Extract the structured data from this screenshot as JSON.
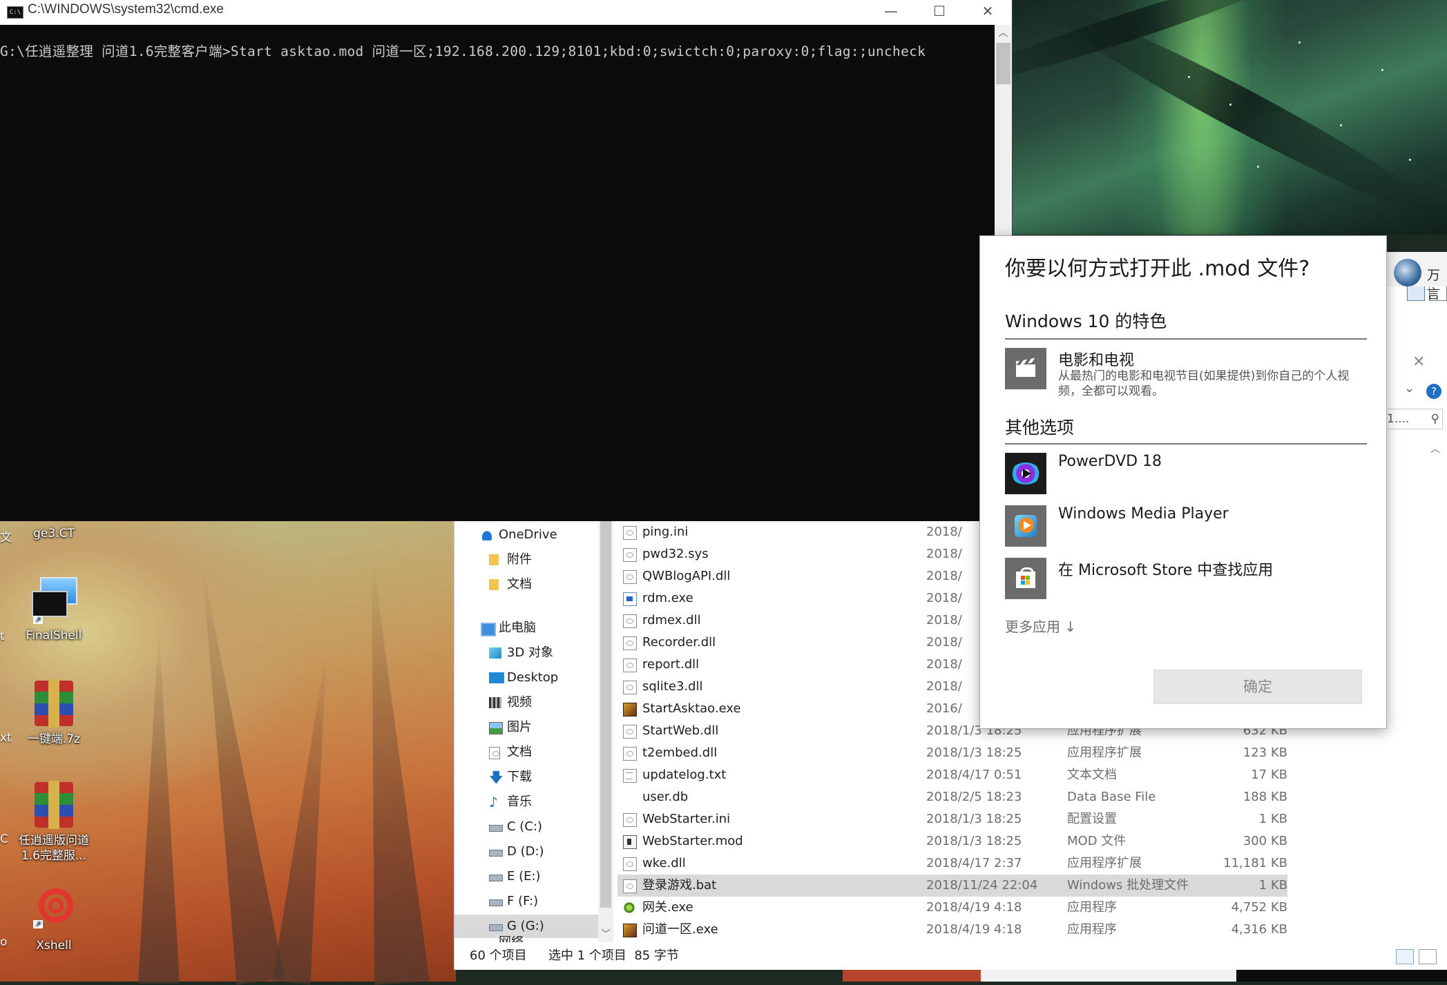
{
  "cmd": {
    "title": "C:\\WINDOWS\\system32\\cmd.exe",
    "icon_text": "C:\\",
    "command_line": "G:\\任逍遥整理 问道1.6完整客户端>Start asktao.mod 问道一区;192.168.200.129;8101;kbd:0;swictch:0;paroxy:0;flag:;uncheck",
    "buttons": {
      "minimize": "—",
      "maximize": "☐",
      "close": "✕"
    }
  },
  "desktop": {
    "icons": [
      {
        "label": "ge3.CT",
        "icon": "file-icon"
      },
      {
        "label": "FinalShell",
        "icon": "monitor-icon"
      },
      {
        "label": "一键端.7z",
        "icon": "archive-icon"
      },
      {
        "label": "任逍遥版问道\n1.6完整服...",
        "icon": "archive-icon"
      },
      {
        "label": "Xshell",
        "icon": "shell-icon"
      }
    ],
    "edge_labels": [
      "文",
      "t",
      "xt",
      "C",
      "o"
    ]
  },
  "explorer": {
    "nav": [
      {
        "label": "OneDrive",
        "icon": "cloud-icon"
      },
      {
        "label": "附件",
        "icon": "folder-icon"
      },
      {
        "label": "文档",
        "icon": "folder-icon"
      },
      {
        "label": "此电脑",
        "icon": "pc-icon"
      },
      {
        "label": "3D 对象",
        "icon": "cube-icon"
      },
      {
        "label": "Desktop",
        "icon": "desktop-icon"
      },
      {
        "label": "视频",
        "icon": "video-icon"
      },
      {
        "label": "图片",
        "icon": "picture-icon"
      },
      {
        "label": "文档",
        "icon": "document-icon"
      },
      {
        "label": "下载",
        "icon": "download-icon"
      },
      {
        "label": "音乐",
        "icon": "music-icon"
      },
      {
        "label": "C (C:)",
        "icon": "drive-icon"
      },
      {
        "label": "D (D:)",
        "icon": "drive-icon"
      },
      {
        "label": "E (E:)",
        "icon": "drive-icon"
      },
      {
        "label": "F (F:)",
        "icon": "drive-icon"
      },
      {
        "label": "G (G:)",
        "icon": "drive-icon"
      },
      {
        "label": "网络",
        "icon": "network-icon"
      }
    ],
    "files": [
      {
        "name": "ping.ini",
        "date": "2018/",
        "type": "",
        "size": "",
        "icon": "config-icon"
      },
      {
        "name": "pwd32.sys",
        "date": "2018/",
        "type": "",
        "size": "",
        "icon": "config-icon"
      },
      {
        "name": "QWBlogAPI.dll",
        "date": "2018/",
        "type": "",
        "size": "",
        "icon": "config-icon"
      },
      {
        "name": "rdm.exe",
        "date": "2018/",
        "type": "",
        "size": "",
        "icon": "exe-icon"
      },
      {
        "name": "rdmex.dll",
        "date": "2018/",
        "type": "",
        "size": "",
        "icon": "config-icon"
      },
      {
        "name": "Recorder.dll",
        "date": "2018/",
        "type": "",
        "size": "",
        "icon": "config-icon"
      },
      {
        "name": "report.dll",
        "date": "2018/",
        "type": "",
        "size": "",
        "icon": "config-icon"
      },
      {
        "name": "sqlite3.dll",
        "date": "2018/",
        "type": "",
        "size": "",
        "icon": "config-icon"
      },
      {
        "name": "StartAsktao.exe",
        "date": "2016/",
        "type": "",
        "size": "",
        "icon": "game-icon"
      },
      {
        "name": "StartWeb.dll",
        "date": "2018/1/3 18:25",
        "type": "应用程序扩展",
        "size": "632 KB",
        "icon": "config-icon"
      },
      {
        "name": "t2embed.dll",
        "date": "2018/1/3 18:25",
        "type": "应用程序扩展",
        "size": "123 KB",
        "icon": "config-icon"
      },
      {
        "name": "updatelog.txt",
        "date": "2018/4/17 0:51",
        "type": "文本文档",
        "size": "17 KB",
        "icon": "text-icon"
      },
      {
        "name": "user.db",
        "date": "2018/2/5 18:23",
        "type": "Data Base File",
        "size": "188 KB",
        "icon": "blank-icon"
      },
      {
        "name": "WebStarter.ini",
        "date": "2018/1/3 18:25",
        "type": "配置设置",
        "size": "1 KB",
        "icon": "config-icon"
      },
      {
        "name": "WebStarter.mod",
        "date": "2018/1/3 18:25",
        "type": "MOD 文件",
        "size": "300 KB",
        "icon": "mod-icon"
      },
      {
        "name": "wke.dll",
        "date": "2018/4/17 2:37",
        "type": "应用程序扩展",
        "size": "11,181 KB",
        "icon": "config-icon"
      },
      {
        "name": "登录游戏.bat",
        "date": "2018/11/24 22:04",
        "type": "Windows 批处理文件",
        "size": "1 KB",
        "icon": "config-icon",
        "selected": true
      },
      {
        "name": "网关.exe",
        "date": "2018/4/19 4:18",
        "type": "应用程序",
        "size": "4,752 KB",
        "icon": "gateway-icon"
      },
      {
        "name": "问道一区.exe",
        "date": "2018/4/19 4:18",
        "type": "应用程序",
        "size": "4,316 KB",
        "icon": "game-icon"
      }
    ],
    "status": {
      "count": "60 个项目",
      "selection": "选中 1 个项目  85 字节"
    }
  },
  "open_with": {
    "title": "你要以何方式打开此 .mod 文件?",
    "featured_header": "Windows 10 的特色",
    "featured": [
      {
        "name": "电影和电视",
        "desc": "从最热门的电影和电视节目(如果提供)到你自己的个人视频，全都可以观看。",
        "icon": "clapperboard-icon"
      }
    ],
    "other_header": "其他选项",
    "others": [
      {
        "name": "PowerDVD 18",
        "icon": "powerdvd-icon"
      },
      {
        "name": "Windows Media Player",
        "icon": "media-player-icon"
      },
      {
        "name": "在 Microsoft Store 中查找应用",
        "icon": "store-icon"
      }
    ],
    "more_apps": "更多应用 ↓",
    "ok": "确定"
  },
  "background_window": {
    "name": "万言",
    "search_placeholder": "1...."
  }
}
